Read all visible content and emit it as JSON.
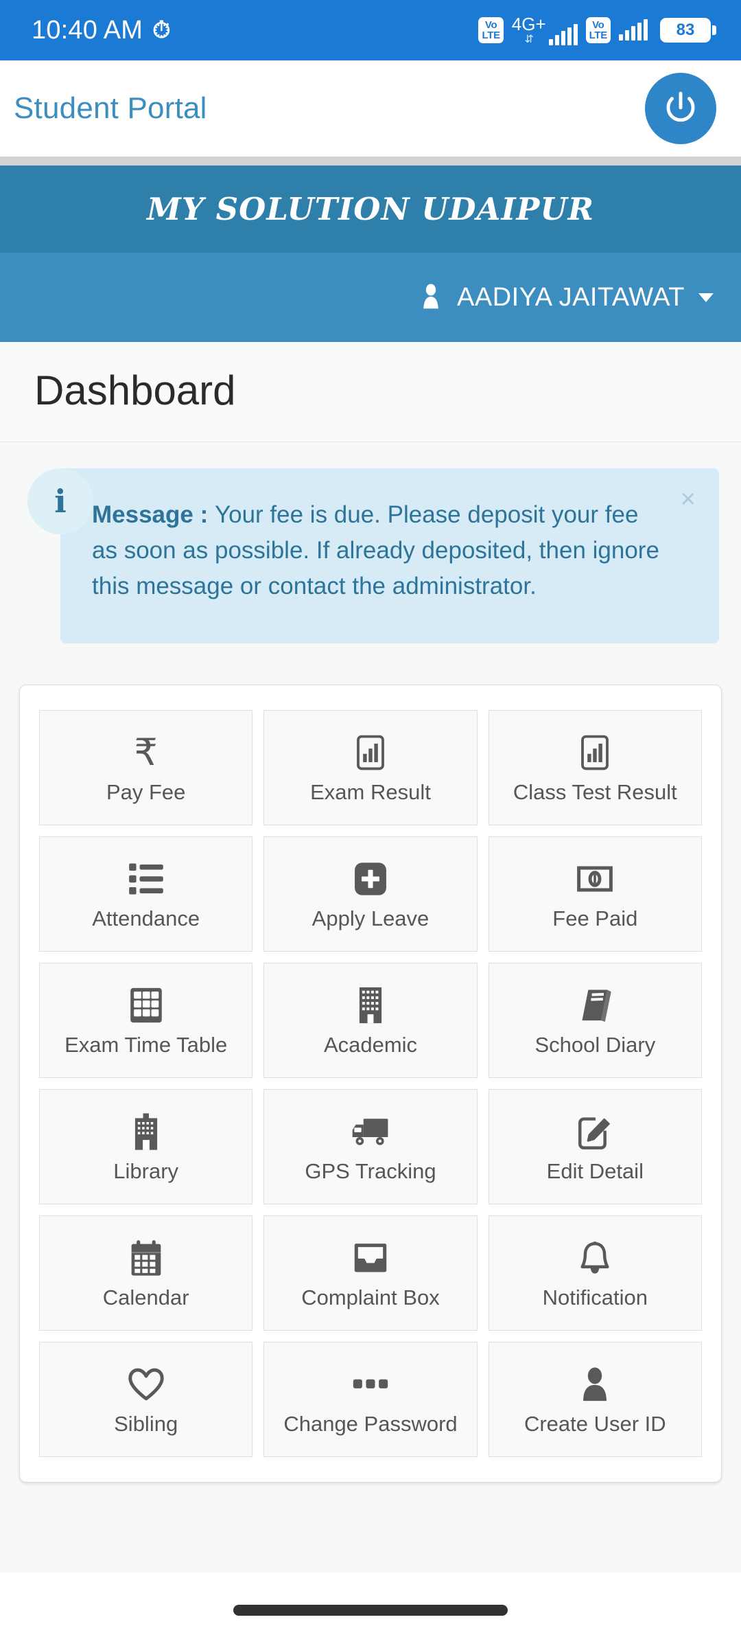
{
  "status_bar": {
    "time": "10:40 AM",
    "alarm_icon": "alarm-icon",
    "sim1": {
      "volte_top": "Vo",
      "volte_bottom": "LTE",
      "network": "4G+",
      "data_arrows": "⇵"
    },
    "sim2": {
      "volte_top": "Vo",
      "volte_bottom": "LTE"
    },
    "battery_percent": "83"
  },
  "app_bar": {
    "title": "Student Portal",
    "power_icon": "power-icon"
  },
  "org_banner": {
    "title": "MY SOLUTION UDAIPUR"
  },
  "user_bar": {
    "user_icon": "user-icon",
    "name": "AADIYA JAITAWAT",
    "caret": "chevron-down-icon"
  },
  "page": {
    "title": "Dashboard"
  },
  "alert": {
    "icon": "info-icon",
    "label": "Message : ",
    "message": "Your fee is due. Please deposit your fee as soon as possible. If already deposited, then ignore this message or contact the administrator.",
    "close_label": "×"
  },
  "colors": {
    "status_bar_blue": "#1B7AD4",
    "brand_blue": "#3C8DC0",
    "banner_blue": "#2E7FAA",
    "alert_bg": "#D6EBF5",
    "alert_text": "#2E7499",
    "tile_bg": "#F9F9F9",
    "icon_gray": "#58595B"
  },
  "tiles": [
    {
      "label": "Pay Fee",
      "icon": "rupee-icon"
    },
    {
      "label": "Exam Result",
      "icon": "bar-chart-icon"
    },
    {
      "label": "Class Test Result",
      "icon": "bar-chart-icon"
    },
    {
      "label": "Attendance",
      "icon": "list-icon"
    },
    {
      "label": "Apply Leave",
      "icon": "plus-square-icon"
    },
    {
      "label": "Fee Paid",
      "icon": "banknote-icon"
    },
    {
      "label": "Exam Time Table",
      "icon": "table-grid-icon"
    },
    {
      "label": "Academic",
      "icon": "building-icon"
    },
    {
      "label": "School Diary",
      "icon": "book-icon"
    },
    {
      "label": "Library",
      "icon": "library-building-icon"
    },
    {
      "label": "GPS Tracking",
      "icon": "truck-icon"
    },
    {
      "label": "Edit Detail",
      "icon": "pencil-square-icon"
    },
    {
      "label": "Calendar",
      "icon": "calendar-icon"
    },
    {
      "label": "Complaint Box",
      "icon": "inbox-icon"
    },
    {
      "label": "Notification",
      "icon": "bell-icon"
    },
    {
      "label": "Sibling",
      "icon": "heart-icon"
    },
    {
      "label": "Change Password",
      "icon": "ellipsis-icon"
    },
    {
      "label": "Create User ID",
      "icon": "person-icon"
    }
  ],
  "nav": {
    "pill": "home-gesture-pill"
  }
}
